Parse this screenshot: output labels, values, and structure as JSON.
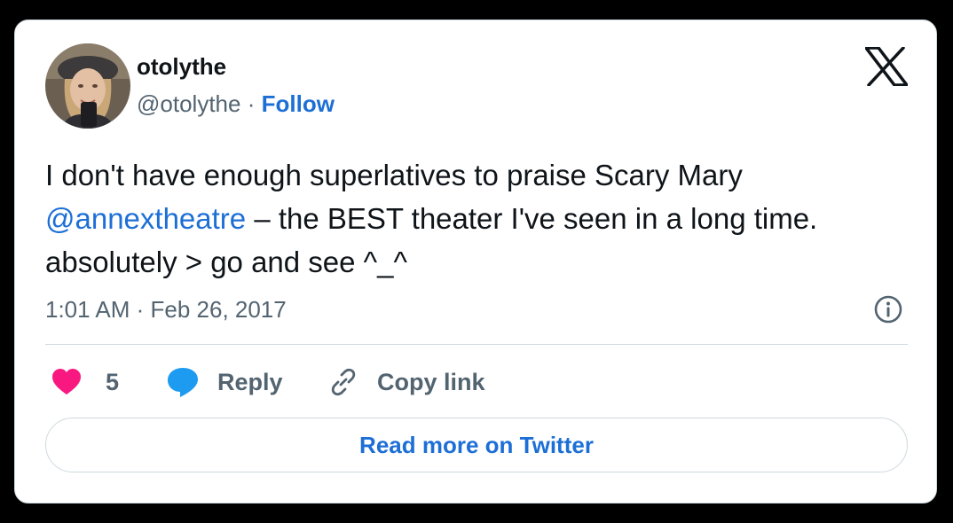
{
  "author": {
    "display_name": "otolythe",
    "handle": "@otolythe",
    "separator": "·",
    "follow_label": "Follow"
  },
  "tweet": {
    "text_before_mention": "I don't have enough superlatives to praise Scary Mary ",
    "mention": "@annextheatre",
    "text_after_mention": " – the BEST theater I've seen in a long time. absolutely > go and see ^_^",
    "timestamp": "1:01 AM · Feb 26, 2017"
  },
  "actions": {
    "like_count": "5",
    "reply_label": "Reply",
    "copy_link_label": "Copy link"
  },
  "read_more_label": "Read more on Twitter",
  "colors": {
    "link_blue": "#1d6fd6",
    "like_pink": "#f91880",
    "reply_blue": "#1d9bf0",
    "secondary_text": "#536471",
    "border": "#cfd9de"
  },
  "icons": {
    "brand": "x-logo-icon",
    "info": "info-icon",
    "like": "heart-icon",
    "reply": "speech-bubble-icon",
    "copy": "link-icon"
  }
}
